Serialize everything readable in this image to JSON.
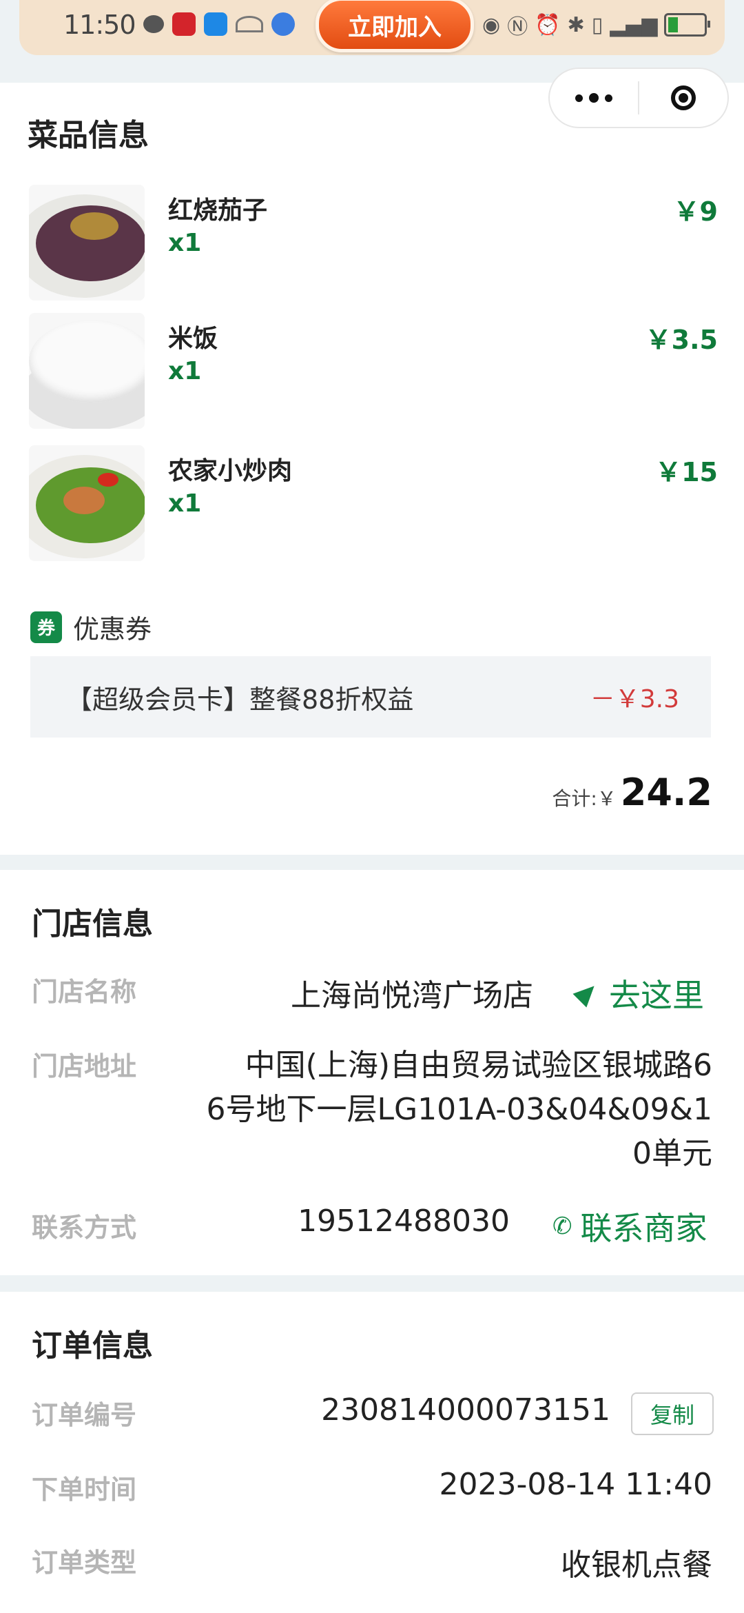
{
  "status_bar": {
    "time": "11:50",
    "join_button": "立即加入"
  },
  "dishes_section": {
    "title": "菜品信息",
    "items": [
      {
        "name": "红烧茄子",
        "qty": "x1",
        "price": "￥9"
      },
      {
        "name": "米饭",
        "qty": "x1",
        "price": "￥3.5"
      },
      {
        "name": "农家小炒肉",
        "qty": "x1",
        "price": "￥15"
      }
    ],
    "coupon": {
      "badge": "券",
      "label": "优惠券",
      "text": "【超级会员卡】整餐88折权益",
      "discount": "－￥3.3"
    },
    "total": {
      "label": "合计:￥",
      "value": "24.2"
    }
  },
  "store_section": {
    "title": "门店信息",
    "name_label": "门店名称",
    "name_value": "上海尚悦湾广场店",
    "navigate": "去这里",
    "address_label": "门店地址",
    "address_lines": [
      "中国(上海)自由贸易试验区银城路6",
      "6号地下一层LG101A-03&04&09&1",
      "0单元"
    ],
    "contact_label": "联系方式",
    "contact_value": "19512488030",
    "contact_merchant": "联系商家"
  },
  "order_section": {
    "title": "订单信息",
    "number_label": "订单编号",
    "number_value": "230814000073151",
    "copy": "复制",
    "time_label": "下单时间",
    "time_value": "2023-08-14 11:40",
    "type_label": "订单类型",
    "type_value": "收银机点餐"
  },
  "colors": {
    "accent_green": "#148a48",
    "price_green": "#0f7a3a",
    "discount_red": "#d23a3a",
    "label_gray": "#b5b5b5"
  }
}
